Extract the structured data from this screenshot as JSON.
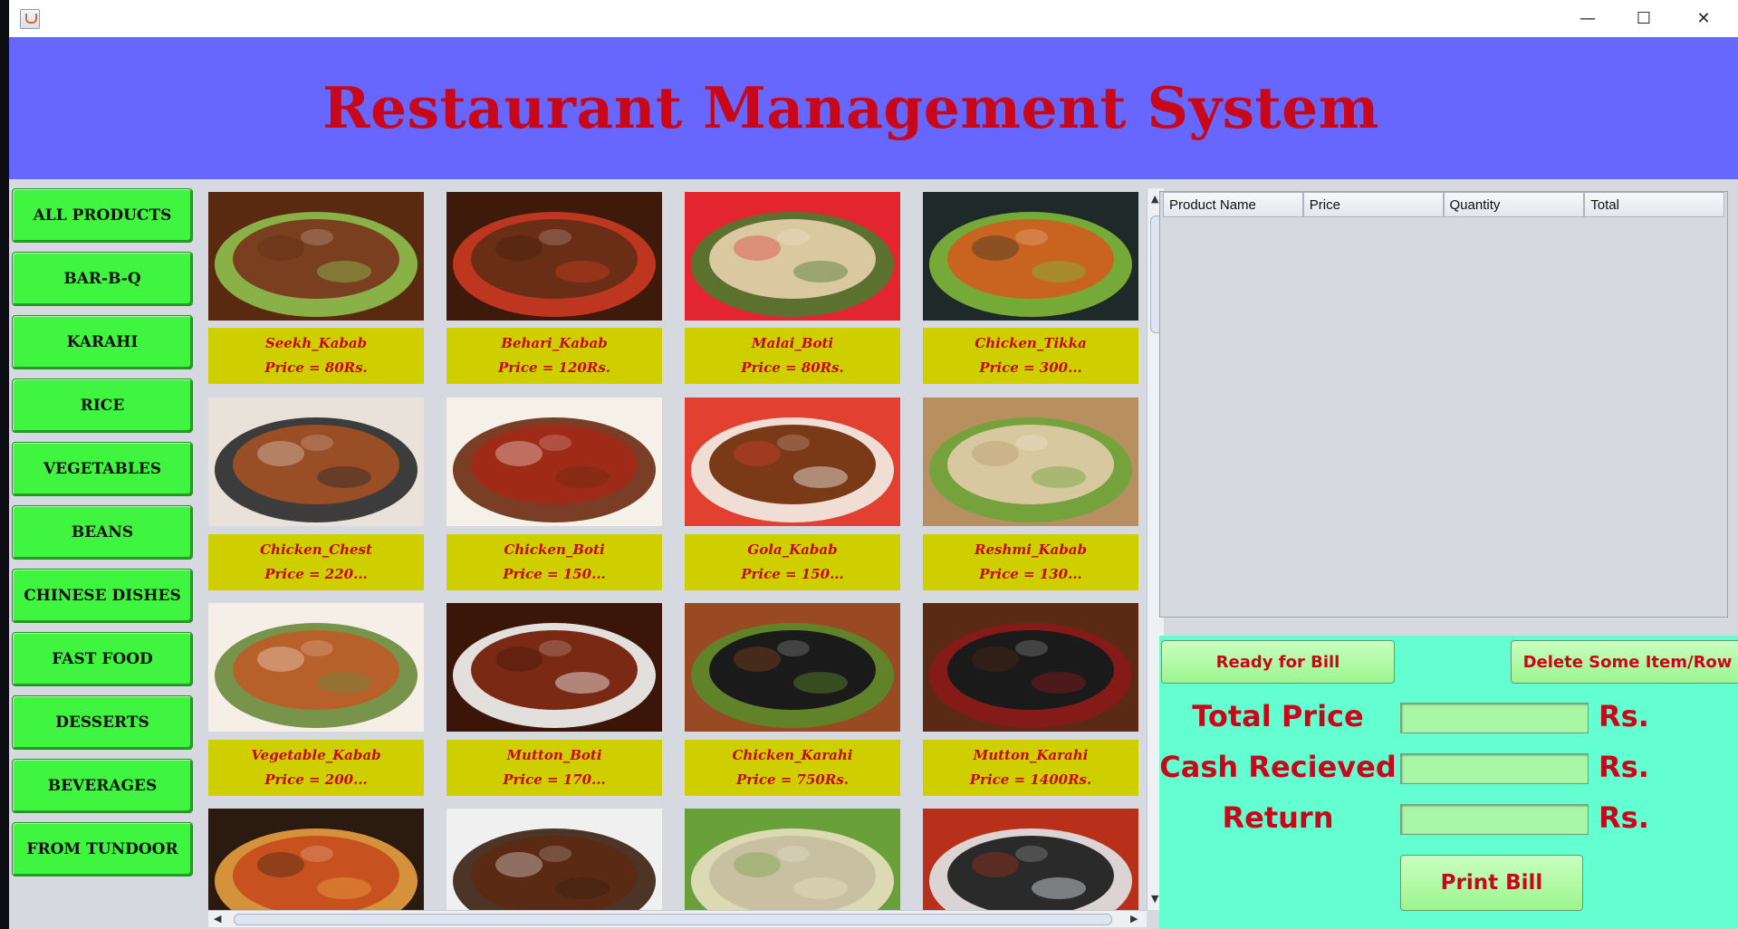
{
  "window": {
    "minimize_glyph": "—",
    "maximize_glyph": "☐",
    "close_glyph": "✕",
    "app_icon": "java-cup-icon"
  },
  "header": {
    "title": "Restaurant Management System"
  },
  "categories": [
    "ALL PRODUCTS",
    "BAR-B-Q",
    "KARAHI",
    "RICE",
    "VEGETABLES",
    "BEANS",
    "CHINESE DISHES",
    "FAST FOOD",
    "DESSERTS",
    "BEVERAGES",
    "FROM TUNDOOR"
  ],
  "products": [
    {
      "name": "Seekh_Kabab",
      "price": "Price = 80Rs.",
      "colors": [
        "#7a3f1f",
        "#5a2a10",
        "#8fbf4f"
      ]
    },
    {
      "name": "Behari_Kabab",
      "price": "Price = 120Rs.",
      "colors": [
        "#6a2e16",
        "#3d1a0a",
        "#cc3a22"
      ]
    },
    {
      "name": "Malai_Boti",
      "price": "Price = 80Rs.",
      "colors": [
        "#d9c8a0",
        "#e3252f",
        "#4d7a30"
      ]
    },
    {
      "name": "Chicken_Tikka",
      "price": "Price = 300...",
      "colors": [
        "#c8641f",
        "#1e2a2a",
        "#7fb83a"
      ]
    },
    {
      "name": "Chicken_Chest",
      "price": "Price = 220...",
      "colors": [
        "#9a4e25",
        "#e8e2da",
        "#2a2a2a"
      ]
    },
    {
      "name": "Chicken_Boti",
      "price": "Price = 150...",
      "colors": [
        "#a02a18",
        "#f5f0e8",
        "#6b2a10"
      ]
    },
    {
      "name": "Gola_Kabab",
      "price": "Price = 150...",
      "colors": [
        "#7a3a18",
        "#e24030",
        "#f2efe8"
      ]
    },
    {
      "name": "Reshmi_Kabab",
      "price": "Price = 130...",
      "colors": [
        "#d8c8a0",
        "#b89060",
        "#6fa43a"
      ]
    },
    {
      "name": "Vegetable_Kabab",
      "price": "Price = 200...",
      "colors": [
        "#b8602a",
        "#f5efe8",
        "#6a8a3a"
      ]
    },
    {
      "name": "Mutton_Boti",
      "price": "Price = 170...",
      "colors": [
        "#7a2a14",
        "#3a1508",
        "#f5f5f5"
      ]
    },
    {
      "name": "Chicken_Karahi",
      "price": "Price = 750Rs.",
      "colors": [
        "#1a1a1a",
        "#9a4a22",
        "#5a8a2a"
      ]
    },
    {
      "name": "Mutton_Karahi",
      "price": "Price = 1400Rs.",
      "colors": [
        "#1a1a1a",
        "#5a2a14",
        "#8a1a1a"
      ]
    },
    {
      "colors": [
        "#c8521f",
        "#2a1a10",
        "#e8a040"
      ]
    },
    {
      "colors": [
        "#5a2a14",
        "#f0f0f0",
        "#3a2010"
      ]
    },
    {
      "colors": [
        "#c8c0a0",
        "#6aa03a",
        "#e8e0c0"
      ]
    },
    {
      "colors": [
        "#2a2a2a",
        "#b8301a",
        "#e0e6ea"
      ]
    }
  ],
  "table": {
    "columns": [
      "Product Name",
      "Price",
      "Quantity",
      "Total"
    ]
  },
  "bill": {
    "ready_label": "Ready for Bill",
    "delete_label": "Delete Some Item/Row",
    "total_label": "Total Price",
    "cash_label": "Cash Recieved",
    "return_label": "Return",
    "currency": "Rs.",
    "print_label": "Print Bill"
  },
  "scroll": {
    "up": "▲",
    "down": "▼",
    "left": "◀",
    "right": "▶"
  }
}
